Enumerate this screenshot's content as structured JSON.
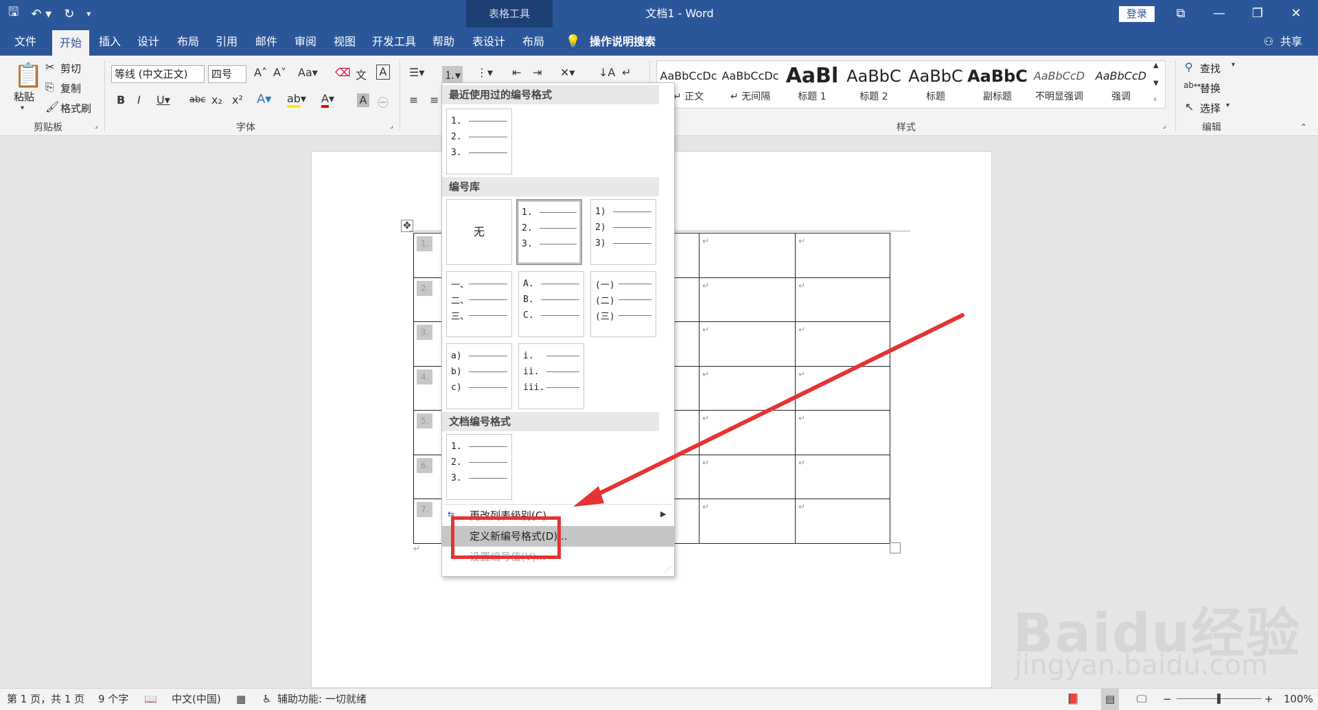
{
  "app": {
    "table_tools": "表格工具",
    "title": "文档1 - Word",
    "login": "登录"
  },
  "tabs": [
    "文件",
    "开始",
    "插入",
    "设计",
    "布局",
    "引用",
    "邮件",
    "审阅",
    "视图",
    "开发工具",
    "帮助",
    "表设计",
    "布局"
  ],
  "tell_me": "操作说明搜索",
  "share": "共享",
  "ribbon": {
    "clipboard": {
      "paste": "粘贴",
      "cut": "剪切",
      "copy": "复制",
      "format_painter": "格式刷",
      "label": "剪贴板"
    },
    "font": {
      "font_name": "等线 (中文正文)",
      "font_size": "四号",
      "label": "字体"
    },
    "styles": {
      "label": "样式",
      "items": [
        {
          "sample": "AaBbCcDc",
          "name": "↵ 正文"
        },
        {
          "sample": "AaBbCcDc",
          "name": "↵ 无间隔"
        },
        {
          "sample": "AaBl",
          "name": "标题 1"
        },
        {
          "sample": "AaBbC",
          "name": "标题 2"
        },
        {
          "sample": "AaBbC",
          "name": "标题"
        },
        {
          "sample": "AaBbC",
          "name": "副标题"
        },
        {
          "sample": "AaBbCcD",
          "name": "不明显强调"
        },
        {
          "sample": "AaBbCcD",
          "name": "强调"
        }
      ]
    },
    "editing": {
      "find": "查找",
      "replace": "替换",
      "select": "选择",
      "label": "编辑"
    }
  },
  "dropdown": {
    "recent_header": "最近使用过的编号格式",
    "library_header": "编号库",
    "document_header": "文档编号格式",
    "none_label": "无",
    "formats": {
      "decimal_dot": [
        "1.",
        "2.",
        "3."
      ],
      "decimal_paren": [
        "1)",
        "2)",
        "3)"
      ],
      "chinese_comma": [
        "一、",
        "二、",
        "三、"
      ],
      "upper_alpha": [
        "A.",
        "B.",
        "C."
      ],
      "chinese_paren": [
        "(一)",
        "(二)",
        "(三)"
      ],
      "lower_alpha": [
        "a)",
        "b)",
        "c)"
      ],
      "lower_roman": [
        "i.",
        "ii.",
        "iii."
      ]
    },
    "menu": {
      "change_level": "更改列表级别(C)",
      "define_new": "定义新编号格式(D)...",
      "set_value": "设置编号值(V)..."
    }
  },
  "table": {
    "numbers": [
      "1.",
      "2.",
      "3.",
      "4.",
      "5.",
      "6.",
      "7."
    ],
    "cell_mark": "↵"
  },
  "status": {
    "page": "第 1 页，共 1 页",
    "words": "9 个字",
    "language": "中文(中国)",
    "accessibility": "辅助功能: 一切就绪",
    "zoom": "100%"
  },
  "watermark": {
    "main": "Baidu经验",
    "sub": "jingyan.baidu.com"
  },
  "colors": {
    "brand": "#2b579a",
    "highlight_box": "#e53333",
    "arrow": "#e53333"
  }
}
